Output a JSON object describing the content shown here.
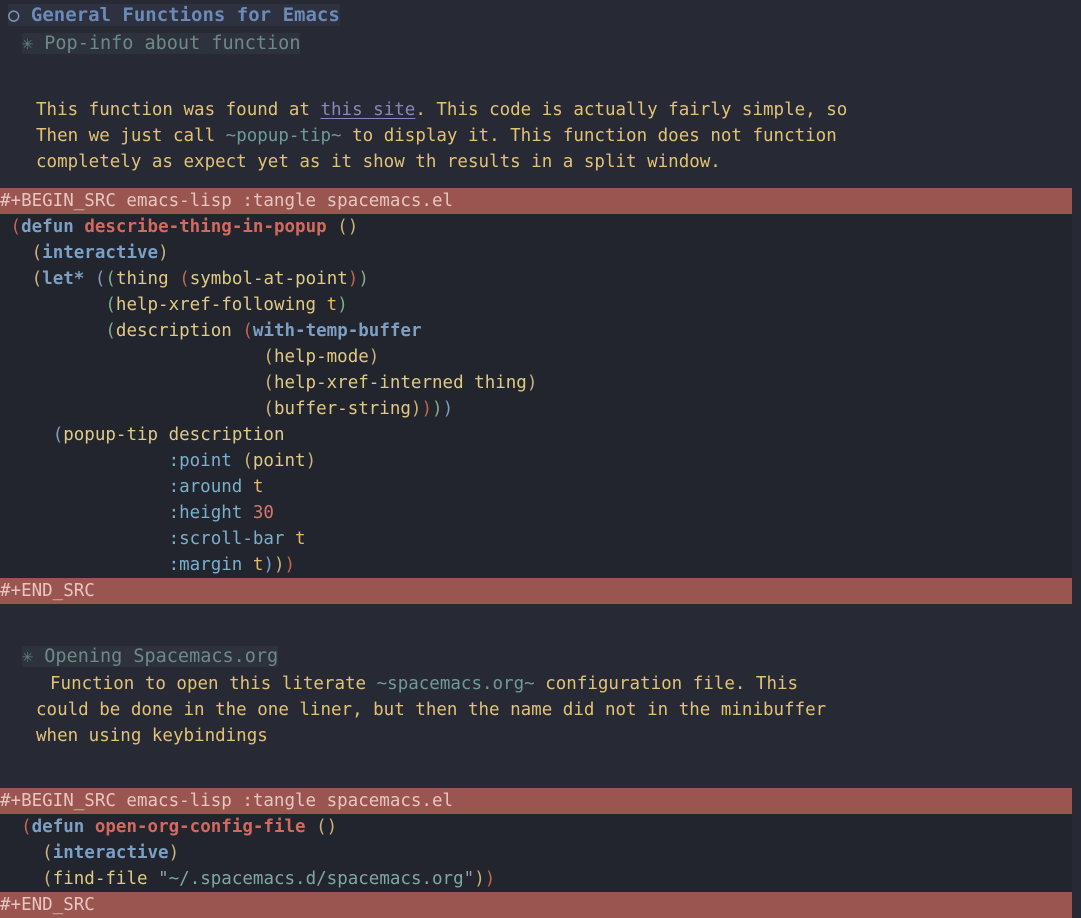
{
  "document": {
    "type": "emacs-org-mode-buffer",
    "theme": "dark"
  },
  "headings": {
    "h1": {
      "bullet": "circle-bullet-icon",
      "bullet_glyph": "○",
      "text": "General Functions for Emacs"
    },
    "h2_first": {
      "bullet": "asterisk-bullet-icon",
      "bullet_glyph": "✳",
      "text": "Pop-info about function"
    },
    "h2_second": {
      "bullet": "asterisk-bullet-icon",
      "bullet_glyph": "✳",
      "text": "Opening Spacemacs.org"
    }
  },
  "paragraph_one": {
    "line1_a": "This function was found at ",
    "line1_link": "this site",
    "line1_b": ". This code is actually fairly simple, so",
    "line2_a": "Then we just call ",
    "line2_verb": "~popup-tip~",
    "line2_b": " to display it. This function does not function",
    "line3": "completely as expect yet as it show th results in a split window."
  },
  "paragraph_two": {
    "line1_a": "Function to open this literate ",
    "line1_verb": "~spacemacs.org~",
    "line1_b": " configuration file. This",
    "line2": "could be done in the one liner, but then the name did not in the minibuffer",
    "line3": "when using keybindings"
  },
  "src_block_one": {
    "begin_directive": "#+BEGIN_SRC",
    "language": "emacs-lisp",
    "header_args": ":tangle spacemacs.el",
    "begin_line": "#+BEGIN_SRC emacs-lisp :tangle spacemacs.el",
    "end_line": "#+END_SRC",
    "code_lines": [
      " (defun describe-thing-in-popup ()",
      "   (interactive)",
      "   (let* ((thing (symbol-at-point))",
      "          (help-xref-following t)",
      "          (description (with-temp-buffer",
      "                         (help-mode)",
      "                         (help-xref-interned thing)",
      "                         (buffer-string))))",
      "     (popup-tip description",
      "                :point (point)",
      "                :around t",
      "                :height 30",
      "                :scroll-bar t",
      "                :margin t)))"
    ]
  },
  "src_block_two": {
    "begin_directive": "#+BEGIN_SRC",
    "language": "emacs-lisp",
    "header_args": ":tangle spacemacs.el",
    "begin_line": "#+BEGIN_SRC emacs-lisp :tangle spacemacs.el",
    "end_line": "#+END_SRC",
    "code_lines": [
      "  (defun open-org-config-file ()",
      "    (interactive)",
      "    (find-file \"~/.spacemacs.d/spacemacs.org\"))"
    ]
  },
  "code_tokens": {
    "defun": "defun",
    "interactive": "interactive",
    "let_star": "let*",
    "with_temp_buffer": "with-temp-buffer",
    "fn_name_one": "describe-thing-in-popup",
    "fn_name_two": "open-org-config-file",
    "thing": "thing",
    "symbol_at_point": "symbol-at-point",
    "help_xref_following": "help-xref-following",
    "description": "description",
    "help_mode": "help-mode",
    "help_xref_interned": "help-xref-interned",
    "buffer_string": "buffer-string",
    "popup_tip": "popup-tip",
    "find_file": "find-file",
    "point": "point",
    "t": "t",
    "kw_point": ":point",
    "kw_around": ":around",
    "kw_height": ":height",
    "kw_scroll_bar": ":scroll-bar",
    "kw_margin": ":margin",
    "height_value": "30",
    "file_path_string": "~/.spacemacs.d/spacemacs.org"
  },
  "colors": {
    "page_background": "#272a35",
    "code_background": "#22242e",
    "src_bar_background": "#9b5551",
    "heading_level1": "#6c8ab8",
    "heading_level2": "#6f8a86",
    "body_text": "#e2c275",
    "link": "#8a86b8",
    "verbatim": "#6f9a99",
    "keyword": "#7c9fc4",
    "function_name": "#d4695c",
    "string": "#7fa8a0",
    "number": "#d4776c"
  }
}
